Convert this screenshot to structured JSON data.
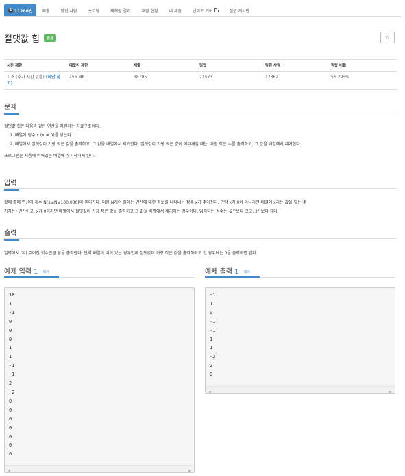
{
  "nav": {
    "tabs": [
      {
        "label": "11286번",
        "active": true
      },
      {
        "label": "제출"
      },
      {
        "label": "맞힌 사람"
      },
      {
        "label": "숏코딩"
      },
      {
        "label": "재채점 결과"
      },
      {
        "label": "채점 현황"
      },
      {
        "label": "내 제출"
      },
      {
        "label": "난이도 기여"
      },
      {
        "label": "질문 게시판"
      }
    ],
    "badge_symbol": "S"
  },
  "problem": {
    "title": "절댓값 힙",
    "status_label": "성공",
    "star_symbol": "☆"
  },
  "stats": {
    "headers": [
      "시간 제한",
      "메모리 제한",
      "제출",
      "정답",
      "맞힌 사람",
      "정답 비율"
    ],
    "time_limit_main": "1 초 (추가 시간 없음)",
    "time_limit_extra": "(하단 참고)",
    "memory_limit": "256 MB",
    "submissions": "38705",
    "accepted": "21573",
    "solvers": "17362",
    "ratio": "56.295%"
  },
  "sections": {
    "problem_title": "문제",
    "problem_intro": "절댓값 힙은 다음과 같은 연산을 지원하는 자료구조이다.",
    "problem_items": [
      "배열에 정수 x (x ≠ 0)를 넣는다.",
      "배열에서 절댓값이 가장 작은 값을 출력하고, 그 값을 배열에서 제거한다. 절댓값이 가장 작은 값이 여러개일 때는, 가장 작은 수를 출력하고, 그 값을 배열에서 제거한다."
    ],
    "problem_outro": "프로그램은 처음에 비어있는 배열에서 시작하게 된다.",
    "input_title": "입력",
    "input_text_1": "첫째 줄에 연산의 개수 N(1≤N≤100,000)이 주어진다. 다음 N개의 줄에는 연산에 대한 정보를 나타내는 정수 x가 주어진다. 만약 x가 0이 아니라면 배열에 x라는 값을 넣는(추",
    "input_text_2": "가하는) 연산이고, x가 0이라면 배열에서 절댓값이 가장 작은 값을 출력하고 그 값을 배열에서 제거하는 경우이다. 입력되는 정수는 -2³¹보다 크고, 2³¹보다 작다.",
    "output_title": "출력",
    "output_text": "입력에서 0이 주어진 회수만큼 답을 출력한다. 만약 배열이 비어 있는 경우인데 절댓값이 가장 작은 값을 출력하라고 한 경우에는 0을 출력하면 된다."
  },
  "samples": {
    "copy_label": "복사",
    "input_label": "예제 입력",
    "input_num": "1",
    "output_label": "예제 출력",
    "output_num": "1",
    "input_lines": [
      "18",
      "1",
      "-1",
      "0",
      "0",
      "0",
      "1",
      "1",
      "-1",
      "-1",
      "2",
      "-2",
      "0",
      "0",
      "0",
      "0",
      "0",
      "0",
      "0"
    ],
    "output_lines": [
      "-1",
      "1",
      "0",
      "-1",
      "-1",
      "1",
      "1",
      "-2",
      "2",
      "0"
    ]
  }
}
